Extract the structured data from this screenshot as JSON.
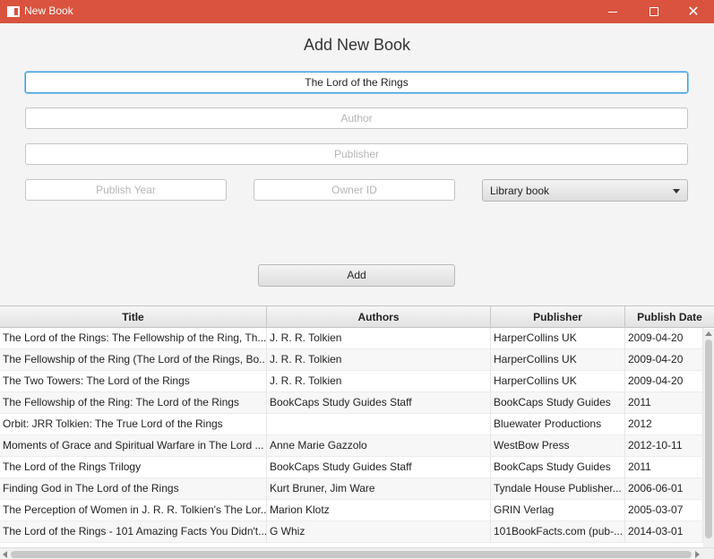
{
  "window": {
    "title": "New Book",
    "accent_color": "#d9533e",
    "minimize_icon": "minimize-icon",
    "maximize_icon": "maximize-icon",
    "close_icon": "close-icon",
    "close_glyph": "✕"
  },
  "form": {
    "heading": "Add New Book",
    "title_value": "The Lord of the Rings",
    "author_placeholder": "Author",
    "publisher_placeholder": "Publisher",
    "publish_year_placeholder": "Publish Year",
    "owner_id_placeholder": "Owner ID",
    "book_type_selected": "Library book",
    "add_label": "Add"
  },
  "table": {
    "columns": [
      "Title",
      "Authors",
      "Publisher",
      "Publish Date"
    ],
    "rows": [
      [
        "The Lord of the Rings: The Fellowship of the Ring, Th...",
        "J. R. R. Tolkien",
        "HarperCollins UK",
        "2009-04-20"
      ],
      [
        "The Fellowship of the Ring (The Lord of the Rings, Bo...",
        "J. R. R. Tolkien",
        "HarperCollins UK",
        "2009-04-20"
      ],
      [
        "The Two Towers: The Lord of the Rings",
        "J. R. R. Tolkien",
        "HarperCollins UK",
        "2009-04-20"
      ],
      [
        "The Fellowship of the Ring: The Lord of the Rings",
        "BookCaps Study Guides Staff",
        "BookCaps Study Guides",
        "2011"
      ],
      [
        "Orbit: JRR Tolkien: The True Lord of the Rings",
        "",
        "Bluewater Productions",
        "2012"
      ],
      [
        "Moments of Grace and Spiritual Warfare in The Lord ...",
        "Anne Marie Gazzolo",
        "WestBow Press",
        "2012-10-11"
      ],
      [
        "The Lord of the Rings Trilogy",
        "BookCaps Study Guides Staff",
        "BookCaps Study Guides",
        "2011"
      ],
      [
        "Finding God in The Lord of the Rings",
        "Kurt Bruner, Jim Ware",
        "Tyndale House Publisher...",
        "2006-06-01"
      ],
      [
        "The Perception of Women in J. R. R. Tolkien's The Lor...",
        "Marion Klotz",
        "GRIN Verlag",
        "2005-03-07"
      ],
      [
        "The Lord of the Rings - 101 Amazing Facts You Didn't...",
        "G Whiz",
        "101BookFacts.com (pub-...",
        "2014-03-01"
      ]
    ]
  }
}
